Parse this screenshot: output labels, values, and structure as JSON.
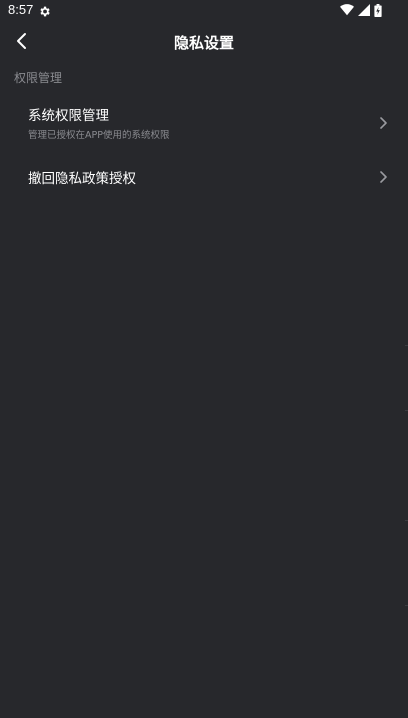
{
  "status_bar": {
    "time": "8:57",
    "icons": [
      "settings-gear-icon",
      "wifi-icon",
      "cellular-signal-icon",
      "battery-charging-icon"
    ]
  },
  "header": {
    "title": "隐私设置",
    "back_icon": "chevron-left-icon"
  },
  "section": {
    "title": "权限管理"
  },
  "rows": [
    {
      "title": "系统权限管理",
      "subtitle": "管理已授权在APP使用的系统权限",
      "icon": "chevron-right-icon"
    },
    {
      "title": "撤回隐私政策授权",
      "icon": "chevron-right-icon"
    }
  ],
  "colors": {
    "background": "#27282c",
    "primary_text": "#ffffff",
    "secondary_text": "#8a8b90"
  }
}
